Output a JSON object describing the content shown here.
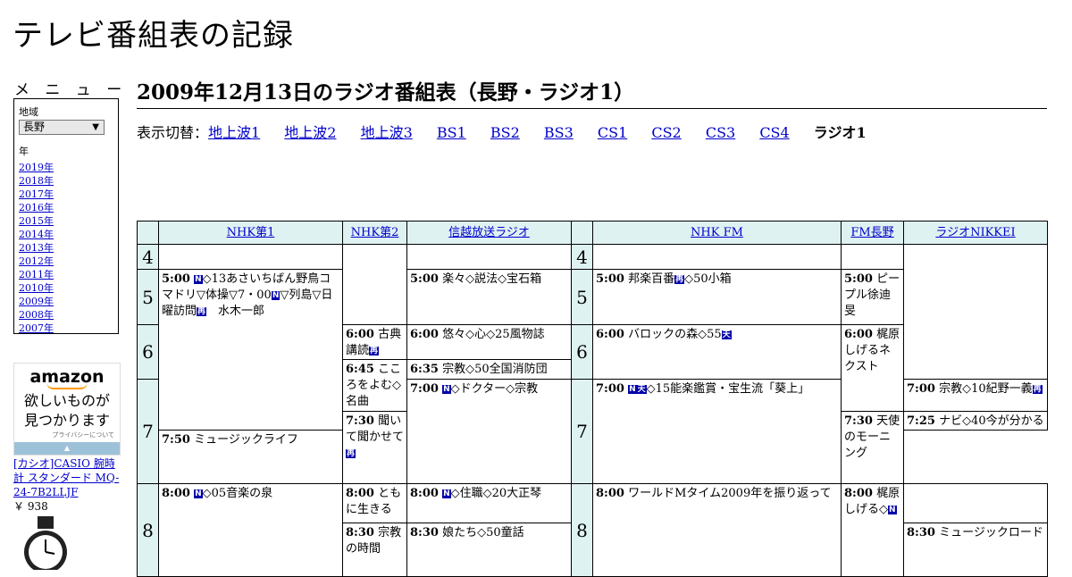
{
  "site": {
    "title": "テレビ番組表の記録"
  },
  "menu": {
    "heading": "メ ニ ュ ー",
    "region_label": "地域",
    "region_value": "長野",
    "year_label": "年",
    "years": [
      "2019年",
      "2018年",
      "2017年",
      "2016年",
      "2015年",
      "2014年",
      "2013年",
      "2012年",
      "2011年",
      "2010年",
      "2009年",
      "2008年",
      "2007年"
    ]
  },
  "ad": {
    "brand": "amazon",
    "line1": "欲しいものが",
    "line2": "見つかります",
    "privacy": "プライバシーについて",
    "product": "[カシオ]CASIO 腕時計 スタンダード MQ-24-7B2LLJF",
    "price": "￥ 938"
  },
  "page": {
    "title": "2009年12月13日のラジオ番組表（長野・ラジオ1）",
    "switch_label": "表示切替：",
    "switch_links": [
      "地上波1",
      "地上波2",
      "地上波3",
      "BS1",
      "BS2",
      "BS3",
      "CS1",
      "CS2",
      "CS3",
      "CS4"
    ],
    "switch_current": "ラジオ1"
  },
  "channels": [
    "NHK第1",
    "NHK第2",
    "信越放送ラジオ",
    "NHK FM",
    "FM長野",
    "ラジオNIKKEI"
  ],
  "hours": [
    "4",
    "5",
    "6",
    "7",
    "8"
  ],
  "programs": {
    "nhk1_5": {
      "time": "5:00",
      "icon1": "N",
      "text": "◇13あさいちばん野鳥コマドリ▽体操▽7・00",
      "icon2": "N",
      "text2": "▽列島▽日曜訪問",
      "icon3": "再",
      "text3": "　水木一郎"
    },
    "nhk1_8": {
      "time": "8:00",
      "icon1": "N",
      "text": "◇05音楽の泉"
    },
    "nhk2_600": {
      "time": "6:00",
      "text": "古典講読",
      "icon1": "再"
    },
    "nhk2_645": {
      "time": "6:45",
      "text": "こころをよむ◇名曲"
    },
    "nhk2_730": {
      "time": "7:30",
      "text": "聞いて聞かせて",
      "icon1": "再"
    },
    "nhk2_800": {
      "time": "8:00",
      "text": "ともに生きる"
    },
    "nhk2_830": {
      "time": "8:30",
      "text": "宗教の時間"
    },
    "sbc_500": {
      "time": "5:00",
      "text": "楽々◇説法◇宝石箱"
    },
    "sbc_600": {
      "time": "6:00",
      "text": "悠々◇心◇25風物誌"
    },
    "sbc_635": {
      "time": "6:35",
      "text": "宗教◇50全国消防団"
    },
    "sbc_700": {
      "time": "7:00",
      "icon1": "N",
      "text": "◇ドクター◇宗教"
    },
    "sbc_800": {
      "time": "8:00",
      "icon1": "N",
      "text": "◇住職◇20大正琴"
    },
    "sbc_830": {
      "time": "8:30",
      "text": "娘たち◇50童話"
    },
    "fm_500": {
      "time": "5:00",
      "text": "邦楽百番",
      "icon1": "再",
      "text2": "◇50小箱"
    },
    "fm_600": {
      "time": "6:00",
      "text": "バロックの森◇55",
      "icon1": "天"
    },
    "fm_700": {
      "time": "7:00",
      "icon1": "N",
      "icon2": "天",
      "text": "◇15能楽鑑賞・宝生流「葵上」"
    },
    "fm_800": {
      "time": "8:00",
      "text": "ワールドMタイム2009年を振り返って"
    },
    "fmn_500": {
      "time": "5:00",
      "text": "ピープル徐迪旻"
    },
    "fmn_600": {
      "time": "6:00",
      "text": "梶原しげるネクスト"
    },
    "fmn_730": {
      "time": "7:30",
      "text": "天使のモーニング"
    },
    "fmn_800": {
      "time": "8:00",
      "text": "梶原しげる◇",
      "icon1": "N"
    },
    "nik_700": {
      "time": "7:00",
      "text": "宗教◇10紀野一義",
      "icon1": "再"
    },
    "nik_725": {
      "time": "7:25",
      "text": "ナビ◇40今が分かる"
    },
    "nik_750": {
      "time": "7:50",
      "text": "ミュージックライフ"
    },
    "nik_830": {
      "time": "8:30",
      "text": "ミュージックロード"
    }
  }
}
